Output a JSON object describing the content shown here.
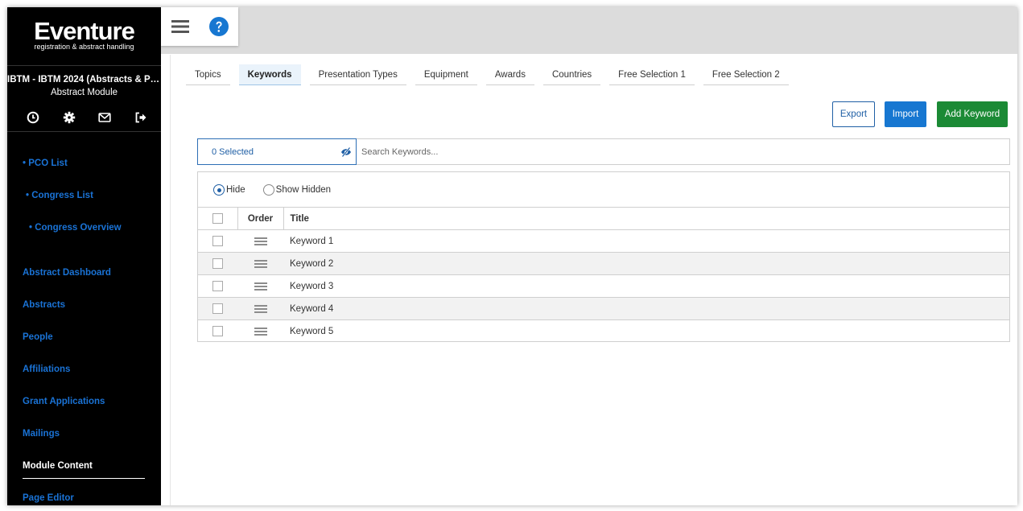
{
  "brand": {
    "name": "Eventure",
    "tagline": "registration & abstract handling"
  },
  "congress": {
    "title": "IBTM - IBTM 2024 (Abstracts & Par...",
    "module": "Abstract Module"
  },
  "sidebar_icons": [
    "clock-icon",
    "gear-icon",
    "mail-icon",
    "logout-icon"
  ],
  "nav": [
    {
      "label": "• PCO List"
    },
    {
      "label": "• Congress List"
    },
    {
      "label": "• Congress Overview"
    },
    {
      "label": "Abstract Dashboard"
    },
    {
      "label": "Abstracts"
    },
    {
      "label": "People"
    },
    {
      "label": "Affiliations"
    },
    {
      "label": "Grant Applications"
    },
    {
      "label": "Mailings"
    },
    {
      "label": "Module Content"
    },
    {
      "label": "Page Editor"
    }
  ],
  "topbar_icons": [
    "hamburger-menu-icon",
    "help-icon"
  ],
  "tabs": [
    {
      "label": "Topics"
    },
    {
      "label": "Keywords"
    },
    {
      "label": "Presentation Types"
    },
    {
      "label": "Equipment"
    },
    {
      "label": "Awards"
    },
    {
      "label": "Countries"
    },
    {
      "label": "Free Selection 1"
    },
    {
      "label": "Free Selection 2"
    }
  ],
  "active_tab": "Keywords",
  "actions": {
    "export": "Export",
    "import": "Import",
    "add": "Add Keyword"
  },
  "selection": {
    "label": "0 Selected"
  },
  "search": {
    "placeholder": "Search Keywords..."
  },
  "filter": {
    "hide": "Hide",
    "show_hidden": "Show Hidden",
    "selected": "Hide"
  },
  "table": {
    "headers": {
      "order": "Order",
      "title": "Title"
    },
    "rows": [
      {
        "title": "Keyword 1"
      },
      {
        "title": "Keyword 2"
      },
      {
        "title": "Keyword 3"
      },
      {
        "title": "Keyword 4"
      },
      {
        "title": "Keyword 5"
      }
    ]
  },
  "colors": {
    "accent_blue": "#1777d1",
    "add_green": "#1b8a35",
    "sidebar_bg": "#000000",
    "nav_link": "#1a73d6"
  }
}
